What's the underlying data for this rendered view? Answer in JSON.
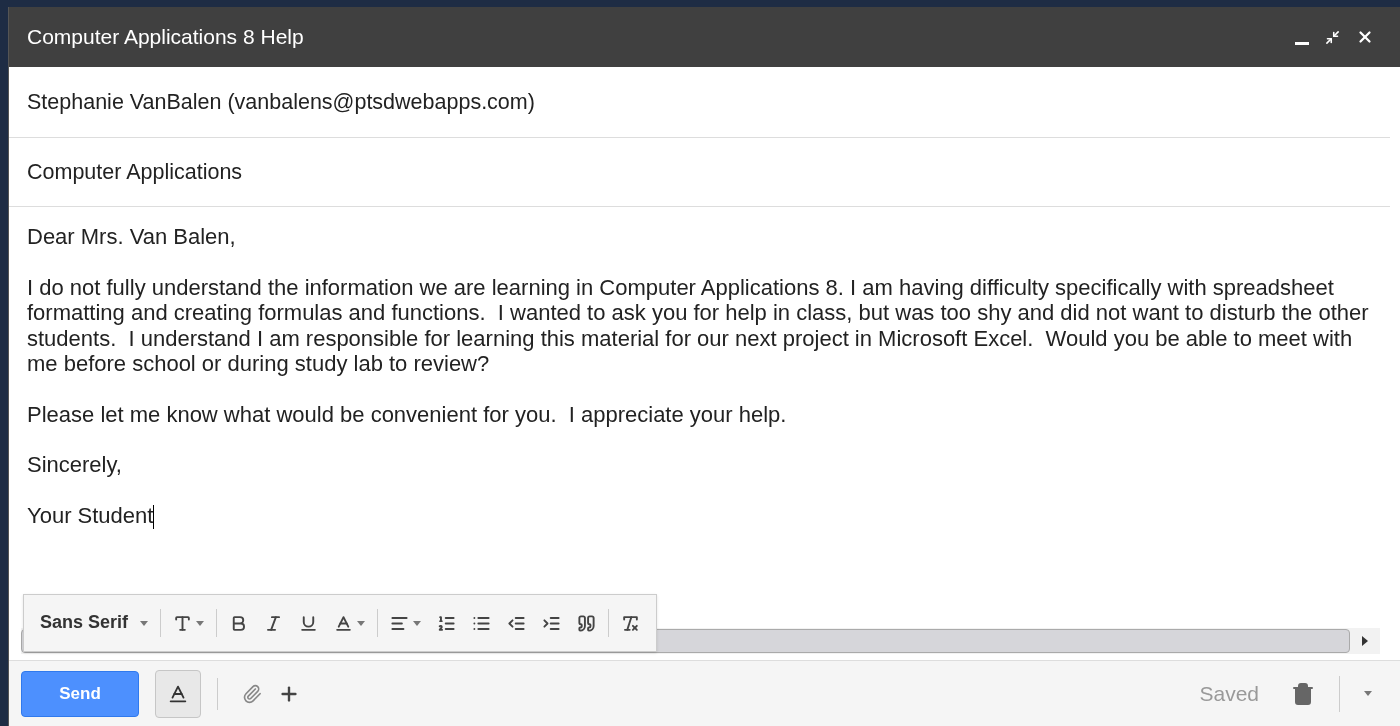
{
  "window": {
    "title": "Computer Applications 8 Help"
  },
  "recipients": "Stephanie VanBalen (vanbalens@ptsdwebapps.com)",
  "subject": "Computer Applications",
  "body": [
    "Dear Mrs. Van Balen,",
    "I do not fully understand the information we are learning in Computer Applications 8. I am having difficulty specifically with spreadsheet formatting and creating formulas and functions.  I wanted to ask you for help in class, but was too shy and did not want to disturb the other students.  I understand I am responsible for learning this material for our next project in Microsoft Excel.  Would you be able to meet with me before school or during study lab to review?",
    "Please let me know what would be convenient for you.  I appreciate your help.",
    "Sincerely,",
    "Your Student"
  ],
  "formatting": {
    "open": true,
    "font": "Sans Serif"
  },
  "send_label": "Send",
  "status": "Saved"
}
